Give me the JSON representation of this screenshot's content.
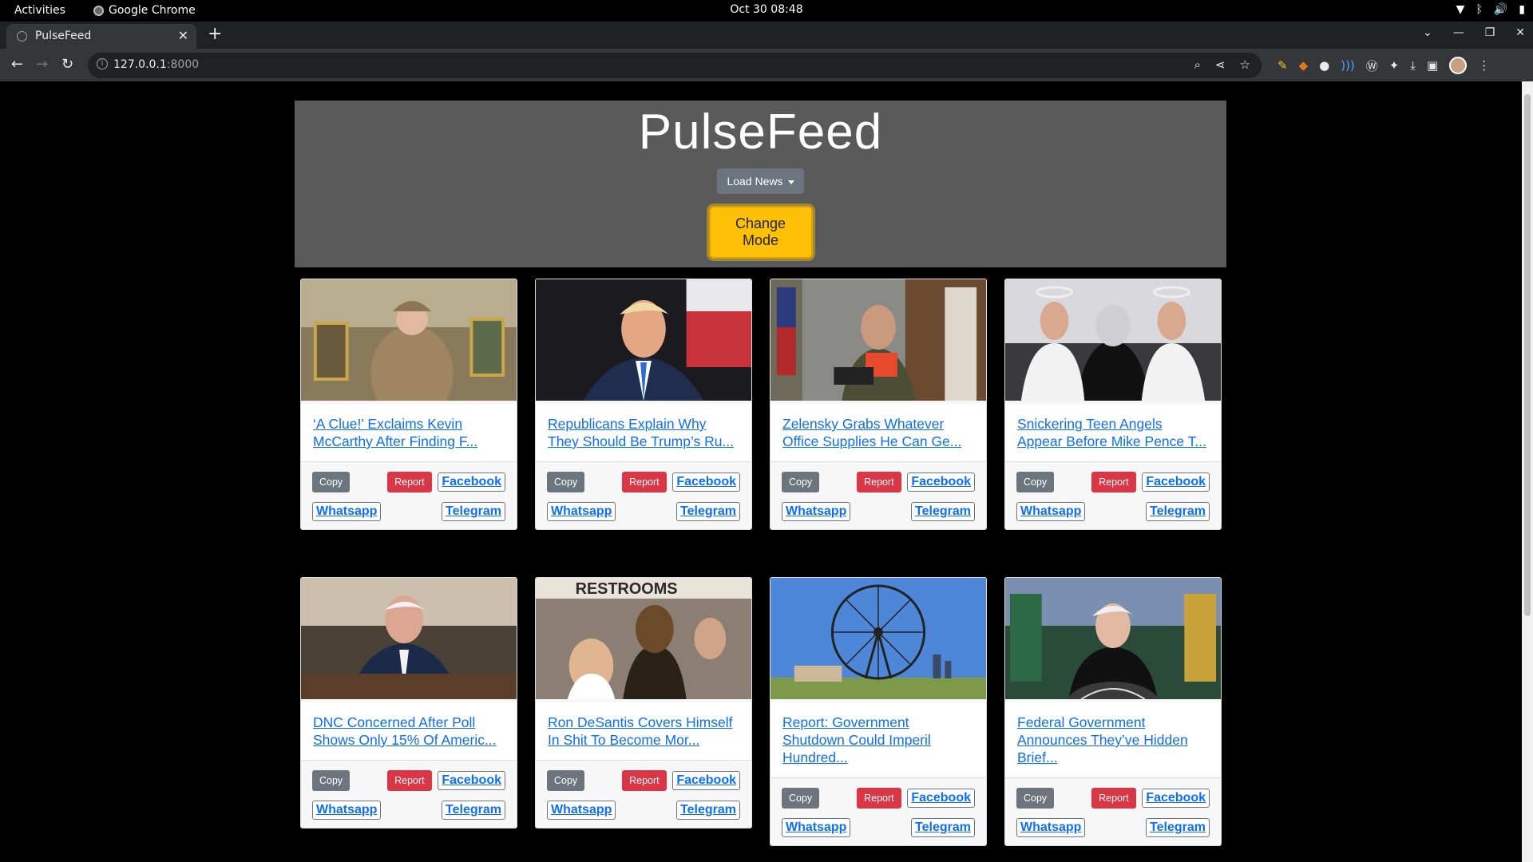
{
  "os_bar": {
    "activities": "Activities",
    "app_name": "Google Chrome",
    "clock": "Oct 30  08:48"
  },
  "browser": {
    "tab_title": "PulseFeed",
    "url_host": "127.0.0.1",
    "url_port": ":8000"
  },
  "page": {
    "title": "PulseFeed",
    "load_news_label": "Load News",
    "change_mode_label": "Change Mode"
  },
  "buttons": {
    "copy": "Copy",
    "report": "Report",
    "facebook": "Facebook",
    "whatsapp": "Whatsapp",
    "telegram": "Telegram"
  },
  "articles": [
    {
      "headline": "‘A Clue!’ Exclaims Kevin McCarthy After Finding F...",
      "image": "mccarthy-detective"
    },
    {
      "headline": "Republicans Explain Why They Should Be Trump’s Ru...",
      "image": "trump"
    },
    {
      "headline": "Zelensky Grabs Whatever Office Supplies He Can Ge...",
      "image": "zelensky"
    },
    {
      "headline": "Snickering Teen Angels Appear Before Mike Pence T...",
      "image": "pence-angels"
    },
    {
      "headline": "DNC Concerned After Poll Shows Only 15% Of Americ...",
      "image": "biden"
    },
    {
      "headline": "Ron DeSantis Covers Himself In Shit To Become Mor...",
      "image": "desantis"
    },
    {
      "headline": "Report: Government Shutdown Could Imperil Hundred...",
      "image": "ferris-wheel"
    },
    {
      "headline": "Federal Government Announces They’ve Hidden Brief...",
      "image": "yellen"
    }
  ]
}
